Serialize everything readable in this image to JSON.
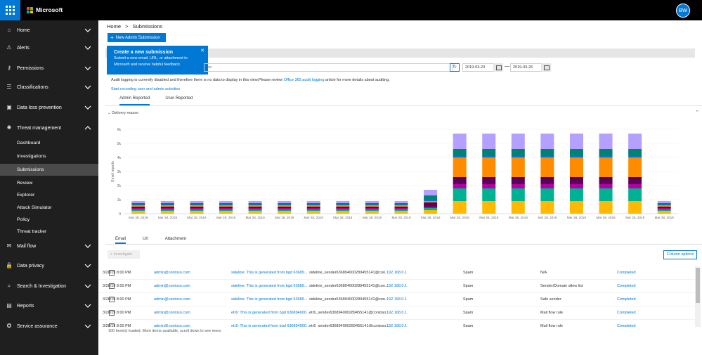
{
  "app": {
    "brand": "Microsoft",
    "user_initials": "BW"
  },
  "colors": {
    "accent": "#0078d4",
    "sidebar_bg": "#1f1f1f",
    "active_item": "#4a4a4a"
  },
  "sidebar": {
    "items": [
      {
        "label": "Home",
        "icon": "home-icon",
        "glyph": "⌂",
        "top": 4,
        "chevron": "down"
      },
      {
        "label": "Alerts",
        "icon": "bell-icon",
        "glyph": "⚠",
        "top": 29,
        "chevron": "down"
      },
      {
        "label": "Permissions",
        "icon": "key-icon",
        "glyph": "⚷",
        "top": 58,
        "chevron": "down"
      },
      {
        "label": "Classifications",
        "icon": "tag-icon",
        "glyph": "☰",
        "top": 85,
        "chevron": "down"
      },
      {
        "label": "Data loss prevention",
        "icon": "shield-icon",
        "glyph": "▣",
        "top": 114,
        "chevron": "down"
      },
      {
        "label": "Threat management",
        "icon": "biohazard-icon",
        "glyph": "✺",
        "top": 143,
        "chevron": "up"
      },
      {
        "label": "Mail flow",
        "icon": "mail-icon",
        "glyph": "✉",
        "top": 311,
        "chevron": "down"
      },
      {
        "label": "Data privacy",
        "icon": "lock-icon",
        "glyph": "🔒",
        "top": 339,
        "chevron": "down"
      },
      {
        "label": "Search & Investigation",
        "icon": "search-icon",
        "glyph": "⌕",
        "top": 368,
        "chevron": "down"
      },
      {
        "label": "Reports",
        "icon": "chart-icon",
        "glyph": "▤",
        "top": 396,
        "chevron": "down"
      },
      {
        "label": "Service assurance",
        "icon": "badge-icon",
        "glyph": "✪",
        "top": 425,
        "chevron": "down"
      }
    ],
    "sub_items": [
      {
        "label": "Dashboard",
        "top": 166
      },
      {
        "label": "Investigations",
        "top": 185
      },
      {
        "label": "Submissions",
        "top": 204,
        "active": true
      },
      {
        "label": "Review",
        "top": 223
      },
      {
        "label": "Explorer",
        "top": 240
      },
      {
        "label": "Attack Simulator",
        "top": 258
      },
      {
        "label": "Policy",
        "top": 275
      },
      {
        "label": "Threat tracker",
        "top": 292
      }
    ]
  },
  "breadcrumb": {
    "home": "Home",
    "separator": ">",
    "current": "Submissions"
  },
  "toolbar": {
    "new_submission": "New Admin Submission"
  },
  "popup": {
    "title": "Create a new submission",
    "line1": "Submit a new email, URL, or attachment to",
    "line2": "Microsoft and receive helpful feedback."
  },
  "filters": {
    "search_value": "ies",
    "date_start": "2019-03-20",
    "date_end": "2019-03-26",
    "date_separator": "—"
  },
  "audit": {
    "text_before": "Audit logging is currently disabled and therefore there is no data to display in this view.Please review ",
    "link": "Office 365 audit logging",
    "text_after": " article for more details about auditing.",
    "start_link": "Start recording user and admin activities"
  },
  "tabs_top": [
    {
      "label": "Admin Reported",
      "active": true
    },
    {
      "label": "User Reported",
      "active": false
    }
  ],
  "delivery_reason": "Delivery reason",
  "chart_data": {
    "type": "bar",
    "stacked": true,
    "ylabel": "Email reports",
    "ylim": [
      0,
      6000
    ],
    "yticks": [
      "0",
      "1k",
      "2k",
      "3k",
      "4k",
      "5k",
      "6k"
    ],
    "categories": [
      "Mar 28, 2019",
      "Mar 28, 2019",
      "Mar 28, 2019",
      "Mar 28, 2019",
      "Mar 28, 2019",
      "Mar 28, 2019",
      "Mar 28, 2019",
      "Mar 28, 2019",
      "Mar 28, 2019",
      "Mar 28, 2019",
      "Mar 28, 2019",
      "Mar 28, 2019",
      "Mar 28, 2019",
      "Mar 28, 2019",
      "Mar 28, 2019",
      "Mar 28, 2019",
      "Mar 28, 2019",
      "Mar 28, 2019",
      "Mar 28, 2019"
    ],
    "series": [
      {
        "color": "#ffb900",
        "values": [
          200,
          200,
          200,
          200,
          200,
          200,
          200,
          200,
          200,
          200,
          250,
          900,
          900,
          900,
          900,
          900,
          900,
          900,
          200
        ]
      },
      {
        "color": "#00b294",
        "values": [
          100,
          100,
          100,
          100,
          100,
          100,
          100,
          100,
          100,
          100,
          150,
          900,
          900,
          900,
          900,
          900,
          900,
          900,
          100
        ]
      },
      {
        "color": "#b4009e",
        "values": [
          100,
          100,
          100,
          100,
          100,
          100,
          100,
          100,
          100,
          100,
          100,
          300,
          300,
          300,
          300,
          300,
          300,
          300,
          100
        ]
      },
      {
        "color": "#5c005c",
        "values": [
          100,
          100,
          100,
          100,
          100,
          100,
          100,
          100,
          100,
          100,
          300,
          500,
          500,
          500,
          500,
          500,
          500,
          500,
          100
        ]
      },
      {
        "color": "#ff8c00",
        "values": [
          100,
          100,
          100,
          100,
          100,
          100,
          100,
          100,
          100,
          100,
          100,
          1400,
          1400,
          1400,
          1400,
          1400,
          1400,
          1400,
          100
        ]
      },
      {
        "color": "#0078d4",
        "values": [
          50,
          50,
          50,
          50,
          50,
          50,
          50,
          50,
          50,
          50,
          100,
          100,
          100,
          100,
          100,
          100,
          100,
          100,
          50
        ]
      },
      {
        "color": "#008272",
        "values": [
          100,
          100,
          100,
          100,
          100,
          100,
          100,
          100,
          100,
          100,
          300,
          500,
          500,
          500,
          500,
          500,
          500,
          500,
          100
        ]
      },
      {
        "color": "#b4a0ff",
        "values": [
          150,
          150,
          150,
          150,
          150,
          150,
          150,
          150,
          150,
          150,
          400,
          1100,
          1100,
          1100,
          1100,
          1100,
          1100,
          1100,
          150
        ]
      }
    ]
  },
  "tabs_bottom": [
    {
      "label": "Email",
      "active": true
    },
    {
      "label": "Url",
      "active": false
    },
    {
      "label": "Attachment",
      "active": false
    }
  ],
  "actions": {
    "investigate": "+ Investigate",
    "column_options": "Column options"
  },
  "table": {
    "rows": [
      {
        "date": "3/28/19 8:00 PM",
        "submitter": "admin@contoso.com",
        "subject": "sideline: This is generated from bgd 63689...",
        "sender": "sideline_sender636894000289455141@con...",
        "ip": "192.168.0.1",
        "category": "Spam",
        "reason": "N/A",
        "status": "Completed"
      },
      {
        "date": "3/28/19 8:00 PM",
        "submitter": "admin@contoso.com",
        "subject": "sideline: This is generated from bgd 63689...",
        "sender": "sideline_sender636894000289455141@con...",
        "ip": "192.168.0.1",
        "category": "Spam",
        "reason": "Sender/Domain allow list",
        "status": "Completed"
      },
      {
        "date": "3/28/19 8:00 PM",
        "submitter": "admin@contoso.com",
        "subject": "sideline: This is generated from bgd 63689...",
        "sender": "sideline_sender636894000289455141@con...",
        "ip": "192.168.0.1",
        "category": "Spam",
        "reason": "Safe sender",
        "status": "Completed"
      },
      {
        "date": "3/28/19 8:00 PM",
        "submitter": "admin@contoso.com",
        "subject": "etr6: This is generated from bgd 636894000...",
        "sender": "etr6_sender636894000289455141@contoso...",
        "ip": "192.168.0.1",
        "category": "Spam",
        "reason": "Mail flow rule",
        "status": "Completed"
      },
      {
        "date": "3/28/19 8:00 PM",
        "submitter": "admin@contoso.com",
        "subject": "etr5: This is generated from bgd 636894000...",
        "sender": "etr5_sender636894000289455141@contoso...",
        "ip": "192.168.0.1",
        "category": "Spam",
        "reason": "Mail flow rule",
        "status": "Completed"
      }
    ],
    "footer": "100 item(s) loaded. More items available, scroll down to see more."
  }
}
